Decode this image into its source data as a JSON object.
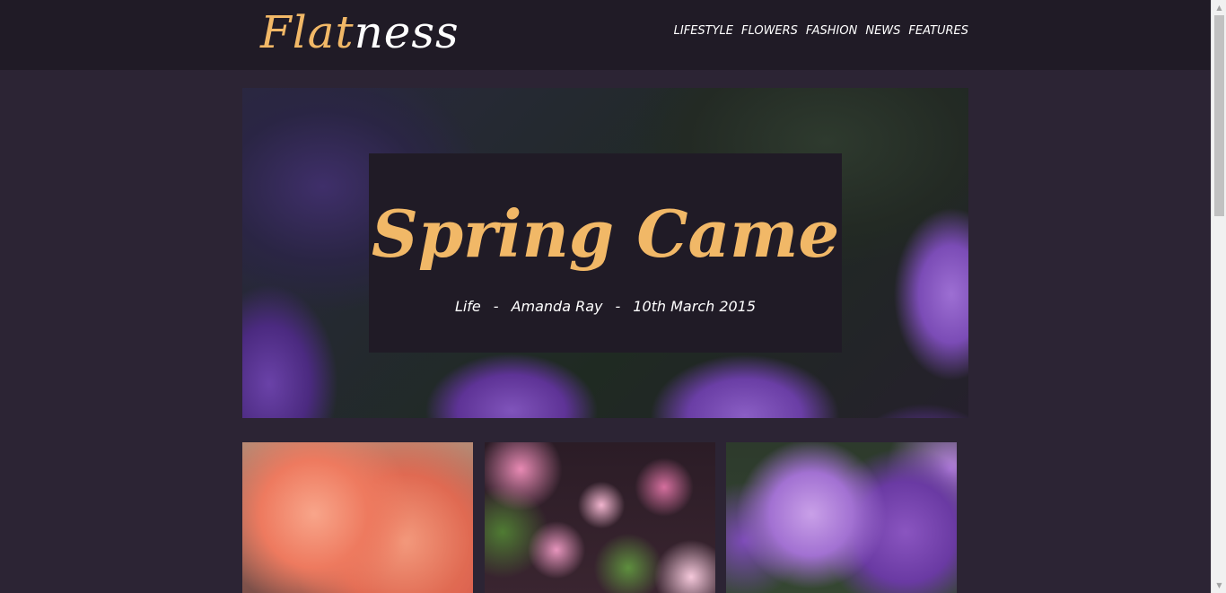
{
  "logo": {
    "part1": "Flat",
    "part2": "ness"
  },
  "nav": [
    "LIFESTYLE",
    "FLOWERS",
    "FASHION",
    "NEWS",
    "FEATURES"
  ],
  "hero": {
    "title": "Spring Came",
    "category": "Life",
    "author": "Amanda Ray",
    "date": "10th March 2015",
    "separator": "-"
  },
  "scrollbar": {
    "up_icon": "▲",
    "down_icon": "▼"
  },
  "colors": {
    "accent": "#f1b867",
    "header_bg": "#201b26",
    "page_bg": "#2c2434",
    "text": "#ffffff"
  }
}
